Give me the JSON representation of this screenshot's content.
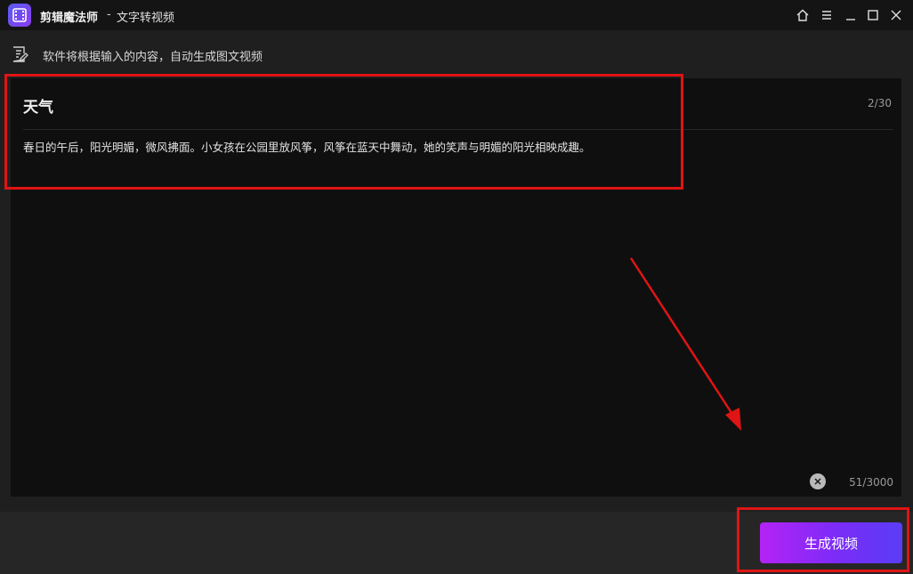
{
  "titlebar": {
    "app_name": "剪辑魔法师",
    "separator": "-",
    "page_title": "文字转视频",
    "icons": [
      "home-icon",
      "menu-icon",
      "minimize-icon",
      "maximize-icon",
      "close-icon"
    ]
  },
  "hint": {
    "icon": "edit-note-icon",
    "text": "软件将根据输入的内容，自动生成图文视频"
  },
  "editor": {
    "title_value": "天气",
    "title_count": "2/30",
    "body_text": "春日的午后，阳光明媚，微风拂面。小女孩在公园里放风筝，风筝在蓝天中舞动，她的笑声与明媚的阳光相映成趣。",
    "body_count": "51/3000",
    "clear_icon": "clear-icon"
  },
  "footer": {
    "generate_label": "生成视频"
  },
  "colors": {
    "annotation": "#e01414",
    "button_gradient_start": "#b423f5",
    "button_gradient_end": "#5a3df6",
    "editor_bg": "#0f0f0f",
    "app_bg": "#1f1f1f"
  }
}
